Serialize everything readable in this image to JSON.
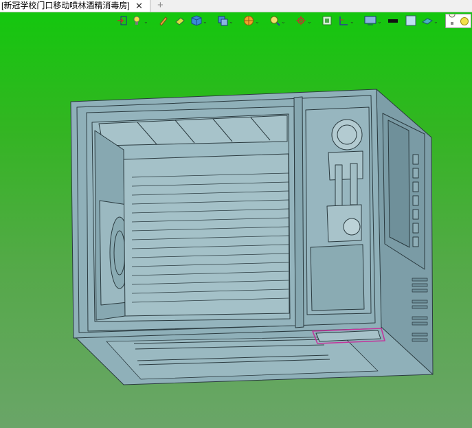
{
  "tab": {
    "title": "[新冠学校门口移动喷林酒精消毒房]",
    "close_glyph": "✕"
  },
  "new_tab_glyph": "+",
  "toolbar": {
    "tools": [
      "exit-sketch-icon",
      "light-bulb-icon",
      "pencil-icon",
      "eraser-icon",
      "cube-view-icon",
      "layers-icon",
      "section-sphere-icon",
      "zoom-icon",
      "rotate-axis-icon",
      "fit-view-icon",
      "measure-icon",
      "display-mode-icon",
      "color-black-icon",
      "color-lightblue-icon",
      "floor-plane-icon",
      "light-toggle-icon"
    ]
  },
  "colors": {
    "viewport_top": "#14c70e",
    "viewport_bottom": "#6aa568",
    "model_fill": "#8fb0b9",
    "model_shadow": "#7d9ea8",
    "model_edge": "#2b3b40",
    "accent_highlight": "#c2379c"
  }
}
